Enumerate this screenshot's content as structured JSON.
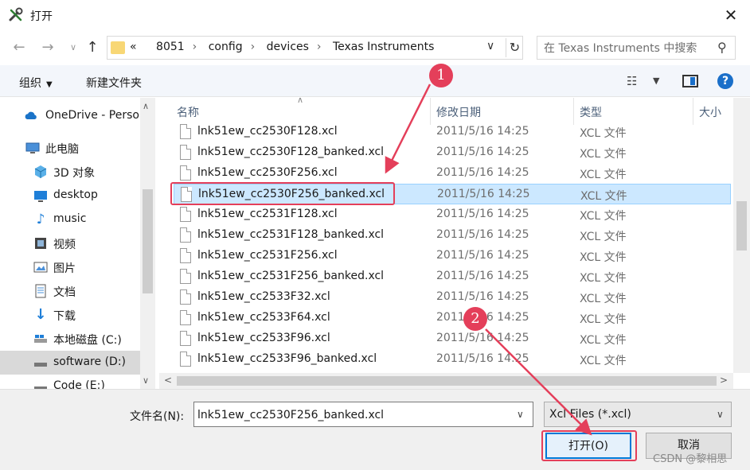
{
  "window": {
    "title": "打开",
    "close_glyph": "✕"
  },
  "address": {
    "prefix": "«",
    "crumbs": [
      "8051",
      "config",
      "devices",
      "Texas Instruments"
    ],
    "search_placeholder": "在 Texas Instruments 中搜索"
  },
  "toolbar": {
    "organize": "组织",
    "new_folder": "新建文件夹",
    "help": "?"
  },
  "nav": {
    "items": [
      {
        "label": "OneDrive - Personal",
        "icon": "cloud-icon"
      },
      {
        "label": "此电脑",
        "icon": "computer-icon"
      },
      {
        "label": "3D 对象",
        "icon": "cube-icon"
      },
      {
        "label": "desktop",
        "icon": "desktop-icon"
      },
      {
        "label": "music",
        "icon": "music-icon"
      },
      {
        "label": "视频",
        "icon": "video-icon"
      },
      {
        "label": "图片",
        "icon": "picture-icon"
      },
      {
        "label": "文档",
        "icon": "document-icon"
      },
      {
        "label": "下载",
        "icon": "download-icon"
      },
      {
        "label": "本地磁盘 (C:)",
        "icon": "drive-icon"
      },
      {
        "label": "software (D:)",
        "icon": "drive-icon"
      },
      {
        "label": "Code (E:)",
        "icon": "drive-icon"
      }
    ]
  },
  "list": {
    "columns": [
      "名称",
      "修改日期",
      "类型",
      "大小"
    ],
    "rows": [
      {
        "name": "lnk51ew_cc2530F128.xcl",
        "date": "2011/5/16 14:25",
        "type": "XCL 文件"
      },
      {
        "name": "lnk51ew_cc2530F128_banked.xcl",
        "date": "2011/5/16 14:25",
        "type": "XCL 文件"
      },
      {
        "name": "lnk51ew_cc2530F256.xcl",
        "date": "2011/5/16 14:25",
        "type": "XCL 文件"
      },
      {
        "name": "lnk51ew_cc2530F256_banked.xcl",
        "date": "2011/5/16 14:25",
        "type": "XCL 文件"
      },
      {
        "name": "lnk51ew_cc2531F128.xcl",
        "date": "2011/5/16 14:25",
        "type": "XCL 文件"
      },
      {
        "name": "lnk51ew_cc2531F128_banked.xcl",
        "date": "2011/5/16 14:25",
        "type": "XCL 文件"
      },
      {
        "name": "lnk51ew_cc2531F256.xcl",
        "date": "2011/5/16 14:25",
        "type": "XCL 文件"
      },
      {
        "name": "lnk51ew_cc2531F256_banked.xcl",
        "date": "2011/5/16 14:25",
        "type": "XCL 文件"
      },
      {
        "name": "lnk51ew_cc2533F32.xcl",
        "date": "2011/5/16 14:25",
        "type": "XCL 文件"
      },
      {
        "name": "lnk51ew_cc2533F64.xcl",
        "date": "2011/5/16 14:25",
        "type": "XCL 文件"
      },
      {
        "name": "lnk51ew_cc2533F96.xcl",
        "date": "2011/5/16 14:25",
        "type": "XCL 文件"
      },
      {
        "name": "lnk51ew_cc2533F96_banked.xcl",
        "date": "2011/5/16 14:25",
        "type": "XCL 文件"
      }
    ]
  },
  "bottom": {
    "filename_label": "文件名(N):",
    "filename_value": "lnk51ew_cc2530F256_banked.xcl",
    "filetype_value": "Xcl Files (*.xcl)",
    "open_label": "打开(O)",
    "cancel_label": "取消"
  },
  "annotations": {
    "step1": "1",
    "step2": "2",
    "color": "#e43f5a"
  },
  "watermark": "CSDN @黎相思"
}
